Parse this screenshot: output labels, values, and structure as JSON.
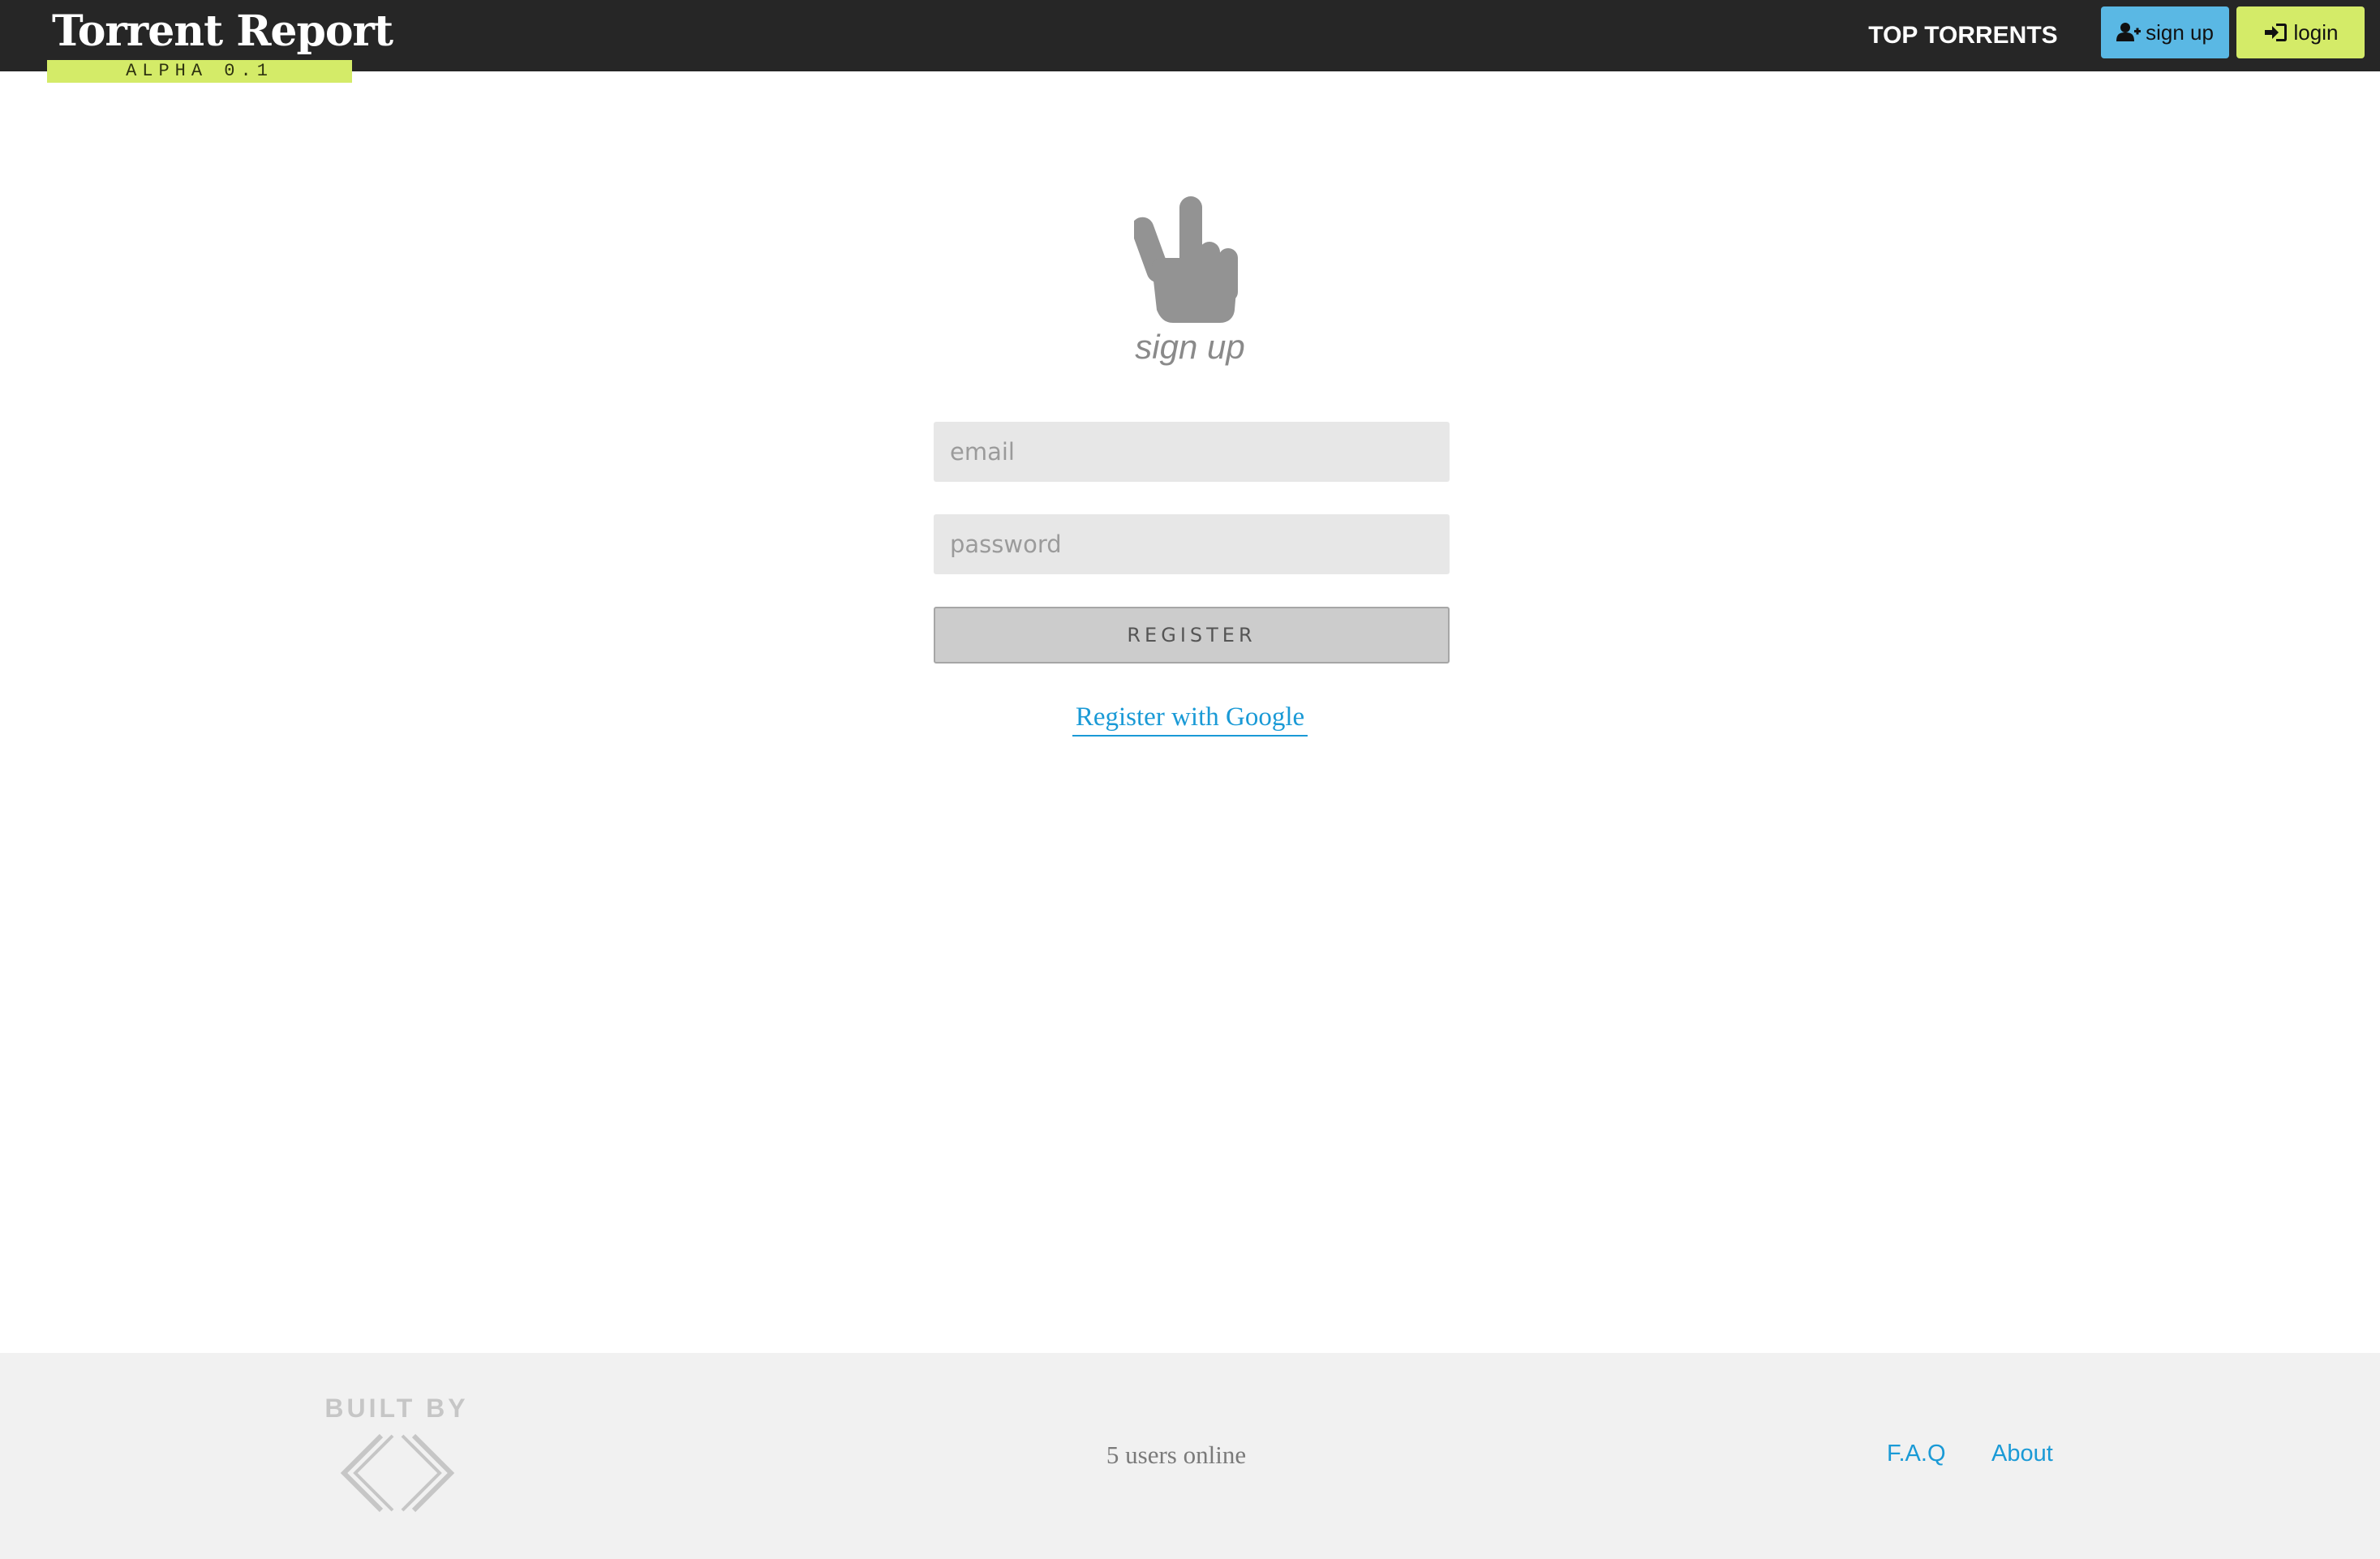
{
  "header": {
    "brand_name": "Torrent Report",
    "brand_badge": "ALPHA 0.1",
    "nav_link": "TOP TORRENTS",
    "signup_label": "sign up",
    "login_label": "login"
  },
  "signup_form": {
    "icon": "peace-hand-icon",
    "title": "sign up",
    "email_placeholder": "email",
    "email_value": "",
    "password_placeholder": "password",
    "password_value": "",
    "register_label": "REGISTER",
    "google_link": "Register with Google"
  },
  "footer": {
    "built_by": "BUILT BY",
    "builder_logo": "code-brackets-logo",
    "users_online": "5 users online",
    "links": [
      "F.A.Q",
      "About"
    ]
  },
  "colors": {
    "header_bg": "#262626",
    "accent_green": "#d4eb68",
    "accent_blue": "#5ab8e4",
    "link_blue": "#1a9ad6",
    "footer_bg": "#f1f1f1"
  }
}
